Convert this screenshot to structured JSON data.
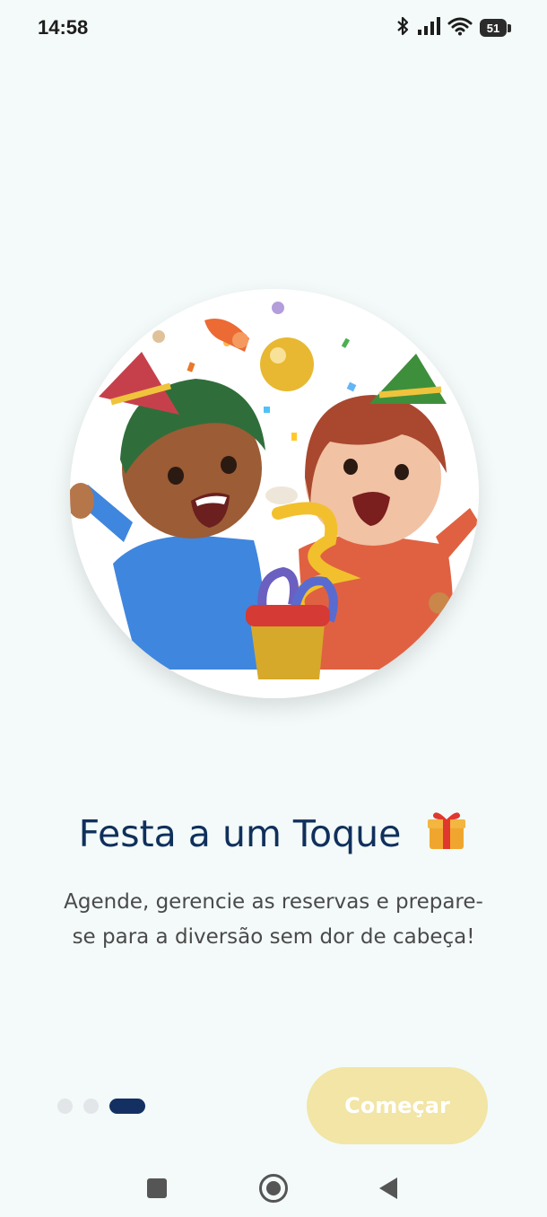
{
  "status_bar": {
    "time": "14:58",
    "battery": "51"
  },
  "onboarding": {
    "title": "Festa a um Toque",
    "title_icon": "gift-icon",
    "subtitle": "Agende, gerencie as reservas e prepare-se para a diversão sem dor de cabeça!",
    "page_count": 3,
    "current_page": 3,
    "start_button_label": "Começar"
  },
  "colors": {
    "background": "#f3faf9",
    "title": "#10305c",
    "button": "#f2e5a5",
    "active_dot": "#143063",
    "inactive_dot": "#e2e6e8"
  },
  "nav_bar": {
    "icons": [
      "recents-square-icon",
      "home-circle-icon",
      "back-triangle-icon"
    ]
  }
}
